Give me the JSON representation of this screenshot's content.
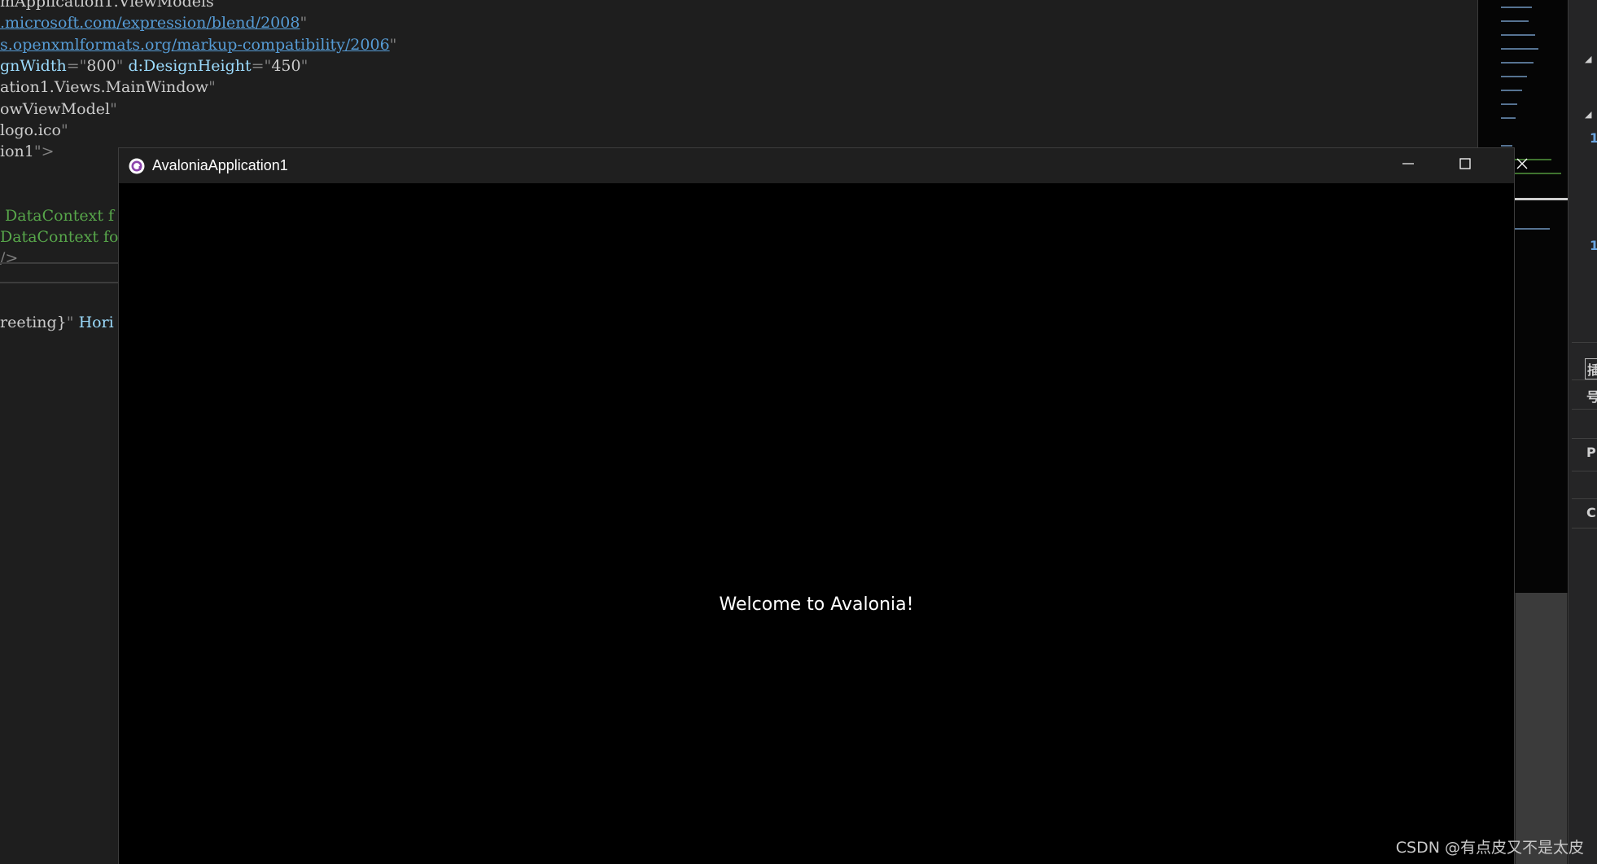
{
  "editor": {
    "lines": [
      {
        "id": "l0",
        "parts": [
          {
            "t": "mApplication1.ViewModels\"",
            "c": "c-str"
          }
        ]
      },
      {
        "id": "l1",
        "parts": [
          {
            "t": ".microsoft.com/expression/blend/2008",
            "c": "c-link"
          },
          {
            "t": "\"",
            "c": "c-q"
          }
        ]
      },
      {
        "id": "l2",
        "parts": [
          {
            "t": "s.openxmlformats.org/markup-compatibility/2006",
            "c": "c-link"
          },
          {
            "t": "\"",
            "c": "c-q"
          }
        ]
      },
      {
        "id": "l3",
        "parts": [
          {
            "t": "gnWidth",
            "c": "c-attr"
          },
          {
            "t": "=\"",
            "c": "c-q"
          },
          {
            "t": "800",
            "c": "c-str"
          },
          {
            "t": "\" ",
            "c": "c-q"
          },
          {
            "t": "d:DesignHeight",
            "c": "c-attr"
          },
          {
            "t": "=\"",
            "c": "c-q"
          },
          {
            "t": "450",
            "c": "c-str"
          },
          {
            "t": "\"",
            "c": "c-q"
          }
        ]
      },
      {
        "id": "l4",
        "parts": [
          {
            "t": "ation1.Views.MainWindow",
            "c": "c-str"
          },
          {
            "t": "\"",
            "c": "c-q"
          }
        ]
      },
      {
        "id": "l5",
        "parts": [
          {
            "t": "owViewModel",
            "c": "c-str"
          },
          {
            "t": "\"",
            "c": "c-q"
          }
        ]
      },
      {
        "id": "l6",
        "parts": [
          {
            "t": "logo.ico",
            "c": "c-str"
          },
          {
            "t": "\"",
            "c": "c-q"
          }
        ]
      },
      {
        "id": "l7",
        "parts": [
          {
            "t": "ion1",
            "c": "c-str"
          },
          {
            "t": "\">",
            "c": "c-q"
          }
        ]
      },
      {
        "id": "l8",
        "parts": [
          {
            "t": " DataContext f",
            "c": "c-cm"
          }
        ]
      },
      {
        "id": "l9",
        "parts": [
          {
            "t": "DataContext fo",
            "c": "c-cm"
          }
        ]
      },
      {
        "id": "l10",
        "parts": [
          {
            "t": "/>",
            "c": "c-punc"
          }
        ]
      },
      {
        "id": "l11",
        "parts": [
          {
            "t": "reeting}",
            "c": "c-str"
          },
          {
            "t": "\" ",
            "c": "c-q"
          },
          {
            "t": "Hori",
            "c": "c-attr"
          }
        ]
      }
    ]
  },
  "right_panel": {
    "glyphs": [
      "◢",
      "1",
      "◢",
      "1",
      "插",
      "号",
      "P",
      "C"
    ]
  },
  "window": {
    "title": "AvaloniaApplication1",
    "icon": "avalonia-logo-icon",
    "minimize_icon": "minimize-icon",
    "maximize_icon": "maximize-icon",
    "close_icon": "close-icon",
    "welcome_text": "Welcome to Avalonia!"
  },
  "watermark": "CSDN @有点皮又不是太皮",
  "colors": {
    "editor_bg": "#1e1e1e",
    "titlebar_bg": "#1f1f1f",
    "client_bg": "#000000",
    "link": "#569cd6",
    "comment": "#57a64a"
  }
}
